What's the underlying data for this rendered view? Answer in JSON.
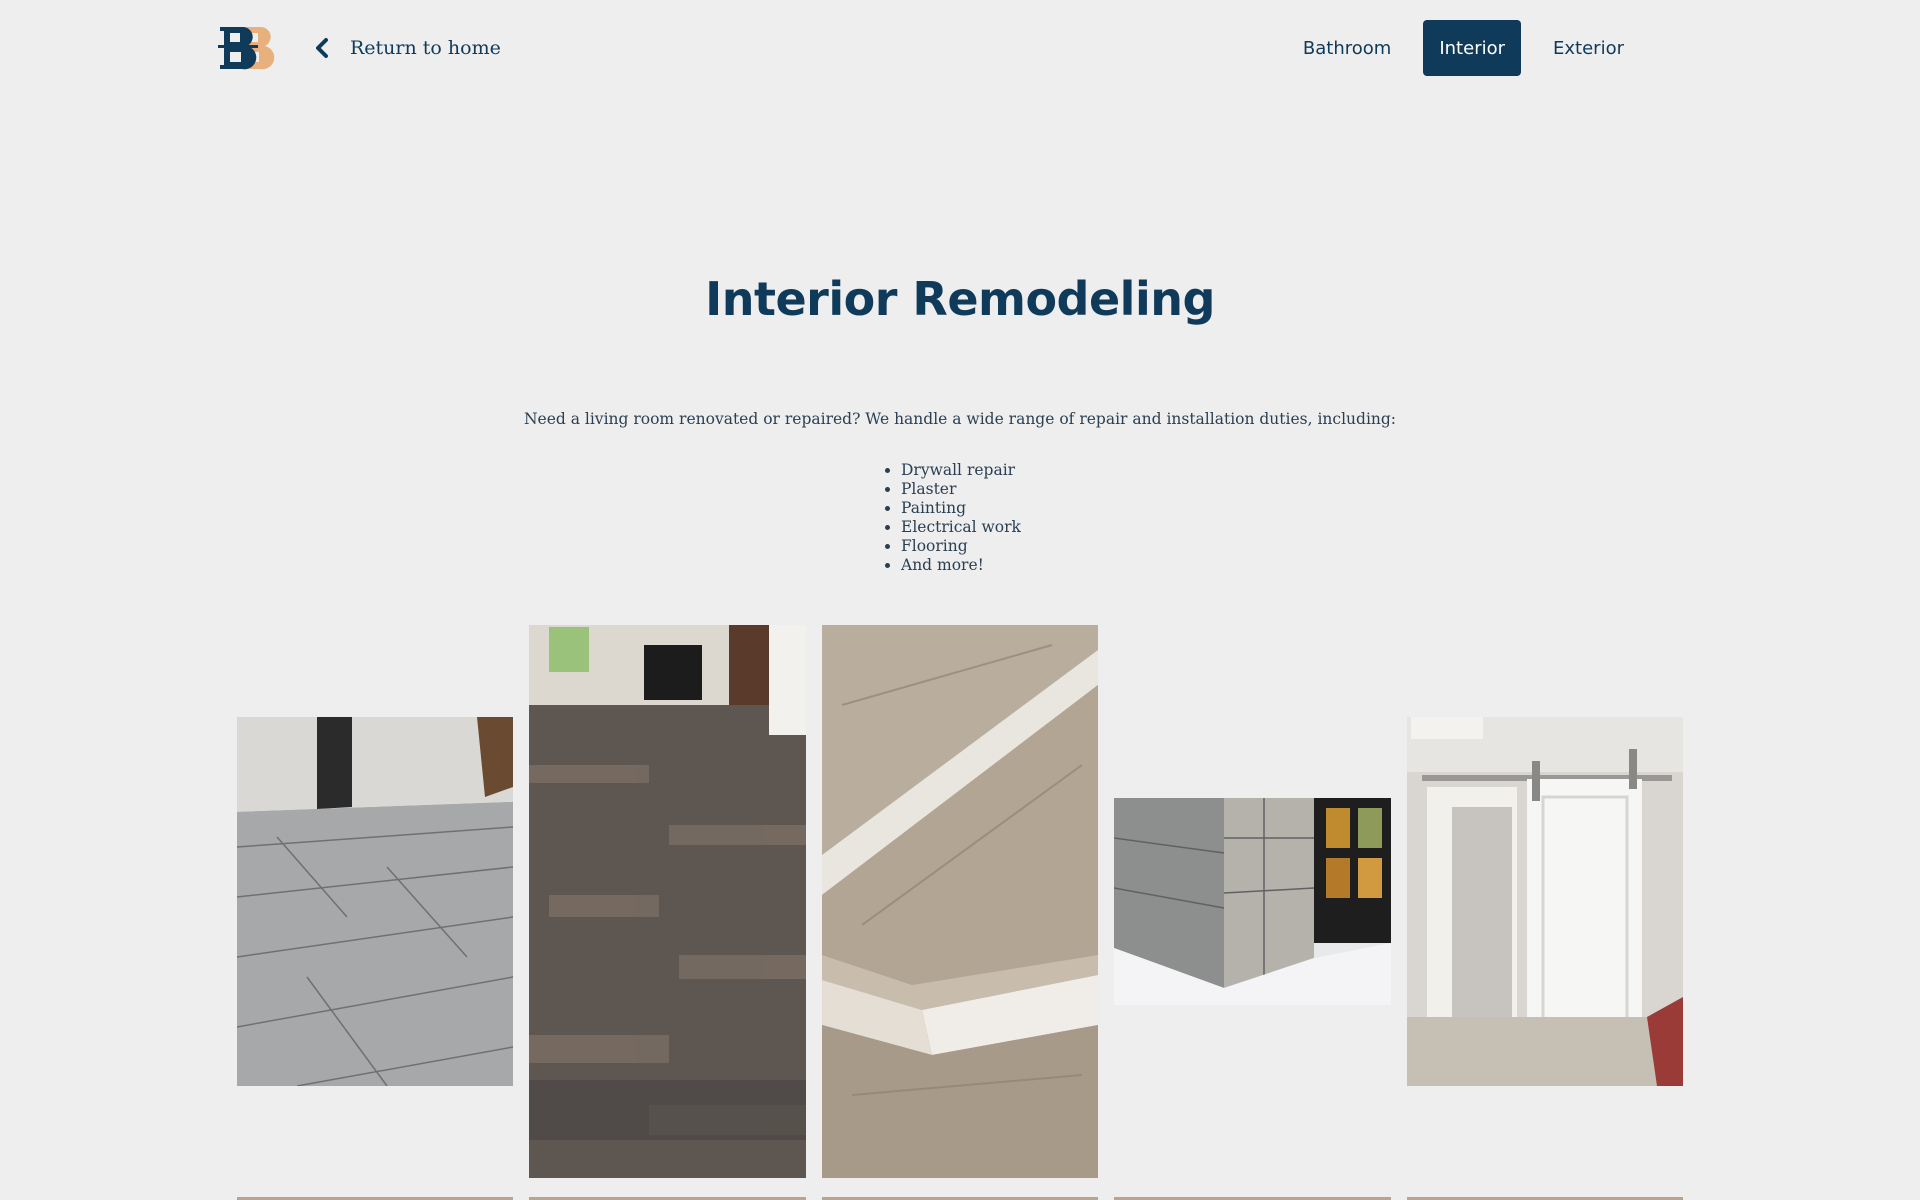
{
  "header": {
    "logo_icon": "bb-logo-icon",
    "back_link_icon": "chevron-left-icon",
    "back_link_label": "Return to home",
    "nav": [
      {
        "label": "Bathroom",
        "active": false
      },
      {
        "label": "Interior",
        "active": true
      },
      {
        "label": "Exterior",
        "active": false
      }
    ]
  },
  "main": {
    "title": "Interior Remodeling",
    "intro": "Need a living room renovated or repaired? We handle a wide range of repair and installation duties, including:",
    "services": [
      "Drywall repair",
      "Plaster",
      "Painting",
      "Electrical work",
      "Flooring",
      "And more!"
    ]
  },
  "gallery": {
    "photos": [
      {
        "subject": "gray wood-look tile floor in empty room"
      },
      {
        "subject": "dark laminate floor leading to fireplace"
      },
      {
        "subject": "light laminate stair treads"
      },
      {
        "subject": "tiled wall beside window"
      },
      {
        "subject": "white sliding barn door"
      }
    ]
  },
  "colors": {
    "background": "#eeeeee",
    "primary": "#0f3a5a",
    "logo_accent": "#e8b07c",
    "body_text": "#2a3f52"
  }
}
